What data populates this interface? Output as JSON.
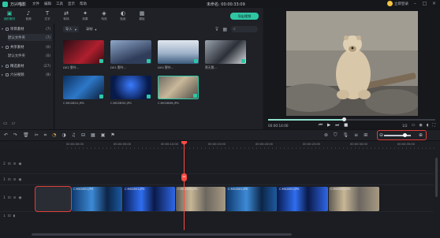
{
  "titlebar": {
    "app_name": "万兴喵影",
    "menu": [
      "文件",
      "编辑",
      "工具",
      "显示",
      "帮助"
    ],
    "doc_title": "未命名: 00:00:33:09",
    "login": "立即登录"
  },
  "toolbar": {
    "tools": [
      {
        "icon": "media-icon",
        "label": "我的素材"
      },
      {
        "icon": "music-icon",
        "label": "音频"
      },
      {
        "icon": "text-icon",
        "label": "文字"
      },
      {
        "icon": "transition-icon",
        "label": "转场"
      },
      {
        "icon": "effects-icon",
        "label": "效果"
      },
      {
        "icon": "element-icon",
        "label": "特效"
      },
      {
        "icon": "split-icon",
        "label": "贴纸"
      },
      {
        "icon": "template-icon",
        "label": "模板"
      }
    ],
    "export_label": "导出视频"
  },
  "left_panel": {
    "items": [
      {
        "label": "项目素材",
        "count": "(7)"
      },
      {
        "label": "默认文件夹",
        "count": "(7)",
        "child": true
      },
      {
        "label": "共享素材",
        "count": "(0)"
      },
      {
        "label": "默认文件夹",
        "count": "(0)",
        "child": true
      },
      {
        "label": "精选素材",
        "count": "(27)"
      },
      {
        "label": "六分视频",
        "count": "(8)"
      }
    ]
  },
  "media": {
    "import_label": "导入",
    "record_label": "录制",
    "items": [
      {
        "caption": "Ω02 野外…"
      },
      {
        "caption": "Ω01 野外…"
      },
      {
        "caption": "Ω04 野外…"
      },
      {
        "caption": "黑天鹅…"
      },
      {
        "caption": "C:M02801.JPG"
      },
      {
        "caption": "C:M02892.JPG"
      },
      {
        "caption": "C:M02869.JPG"
      }
    ]
  },
  "preview": {
    "time": "00:00:14:00",
    "ratio": "1/2",
    "progress": 0.45
  },
  "ruler": {
    "labels": [
      "00:00:00:00",
      "00:00:05:00",
      "00:00:10:00",
      "00:00:15:00",
      "00:00:20:00",
      "00:00:25:00",
      "00:00:30:00",
      "00:00:35:00"
    ]
  },
  "tracks": {
    "heads": [
      {
        "num": "2"
      },
      {
        "num": "1"
      },
      {
        "num": "1"
      },
      {
        "num": "1"
      }
    ],
    "clip_label": "C:M02801.JPG",
    "clips_count": 7
  },
  "zoom": {
    "level": 0.8
  },
  "colors": {
    "accent": "#2ec7a4",
    "highlight": "#e0403a",
    "playhead": "#ff4a44"
  }
}
